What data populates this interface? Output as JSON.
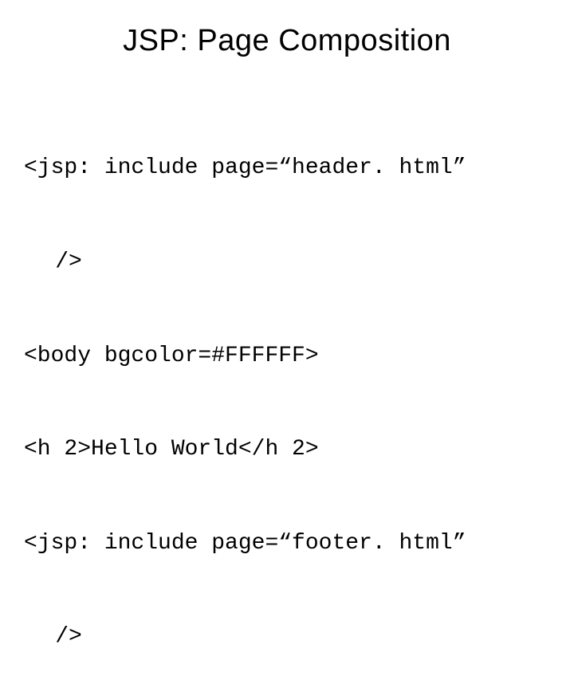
{
  "title": "JSP: Page Composition",
  "code": {
    "line1_part1": "<jsp: include page=“header. html”",
    "line1_part2": "/>",
    "line2": "<body bgcolor=#FFFFFF>",
    "line3": "<h 2>Hello World</h 2>",
    "line4_part1": "<jsp: include page=“footer. html”",
    "line4_part2": "/>"
  }
}
